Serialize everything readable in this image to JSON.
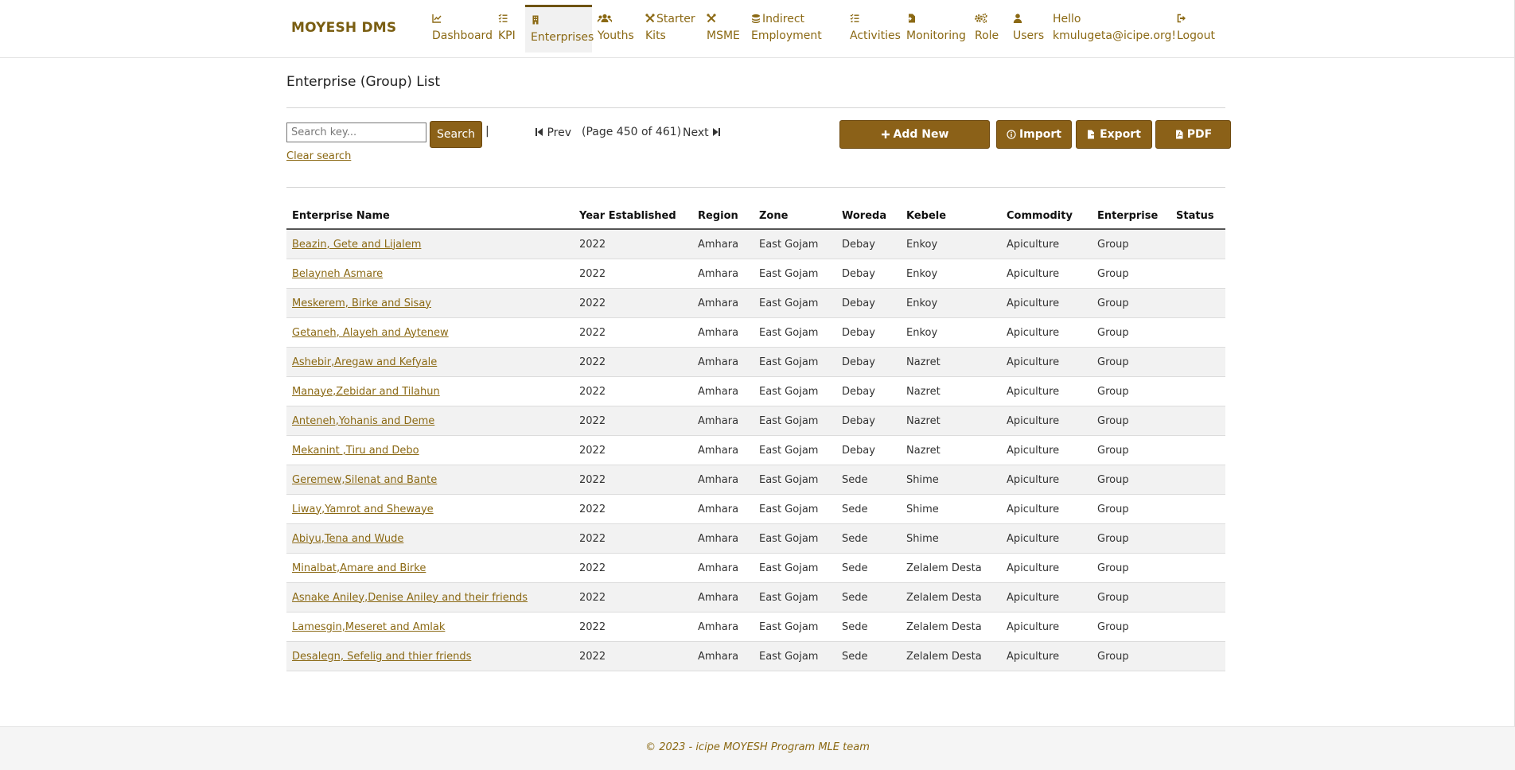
{
  "brand": "MOYESH DMS",
  "nav": [
    {
      "icon": "chart-line-icon",
      "line1": "",
      "line2": "Dashboard"
    },
    {
      "icon": "list-check-icon",
      "line1": "",
      "line2": "KPI"
    },
    {
      "icon": "building-icon",
      "line1": "",
      "line2": "Enterprises"
    },
    {
      "icon": "users-icon",
      "line1": "",
      "line2": "Youths"
    },
    {
      "icon": "tools-icon",
      "line1": "Starter",
      "line2": "Kits"
    },
    {
      "icon": "tools-icon",
      "line1": "",
      "line2": "MSME"
    },
    {
      "icon": "coins-icon",
      "line1": "Indirect",
      "line2": "Employment"
    },
    {
      "icon": "list-check-icon",
      "line1": "",
      "line2": "Activities"
    },
    {
      "icon": "file-import-icon",
      "line1": "",
      "line2": "Monitoring"
    },
    {
      "icon": "cogs-icon",
      "line1": "",
      "line2": "Role"
    },
    {
      "icon": "user-icon",
      "line1": "",
      "line2": "Users"
    },
    {
      "icon": "",
      "line1": "Hello",
      "line2": "kmulugeta@icipe.org!"
    },
    {
      "icon": "sign-out-icon",
      "line1": "",
      "line2": "Logout"
    }
  ],
  "page_title": "Enterprise (Group) List",
  "search": {
    "placeholder": "Search key...",
    "button": "Search",
    "separator": "|",
    "clear": "Clear search"
  },
  "pager": {
    "prev": "Prev",
    "info": "(Page 450 of 461)",
    "next": "Next"
  },
  "actions": {
    "add": "Add New",
    "import": "Import",
    "export": "Export",
    "pdf": "PDF"
  },
  "table": {
    "headers": [
      "Enterprise Name",
      "Year Established",
      "Region",
      "Zone",
      "Woreda",
      "Kebele",
      "Commodity",
      "Enterprise",
      "Status"
    ],
    "rows": [
      [
        "Beazin, Gete and Lijalem",
        "2022",
        "Amhara",
        "East Gojam",
        "Debay",
        "Enkoy",
        "Apiculture",
        "Group",
        ""
      ],
      [
        "Belayneh Asmare",
        "2022",
        "Amhara",
        "East Gojam",
        "Debay",
        "Enkoy",
        "Apiculture",
        "Group",
        ""
      ],
      [
        "Meskerem, Birke and Sisay",
        "2022",
        "Amhara",
        "East Gojam",
        "Debay",
        "Enkoy",
        "Apiculture",
        "Group",
        ""
      ],
      [
        "Getaneh, Alayeh and Aytenew",
        "2022",
        "Amhara",
        "East Gojam",
        "Debay",
        "Enkoy",
        "Apiculture",
        "Group",
        ""
      ],
      [
        "Ashebir,Aregaw and Kefyale",
        "2022",
        "Amhara",
        "East Gojam",
        "Debay",
        "Nazret",
        "Apiculture",
        "Group",
        ""
      ],
      [
        "Manaye,Zebidar and Tilahun",
        "2022",
        "Amhara",
        "East Gojam",
        "Debay",
        "Nazret",
        "Apiculture",
        "Group",
        ""
      ],
      [
        "Anteneh,Yohanis and Deme",
        "2022",
        "Amhara",
        "East Gojam",
        "Debay",
        "Nazret",
        "Apiculture",
        "Group",
        ""
      ],
      [
        "Mekanint ,Tiru and Debo",
        "2022",
        "Amhara",
        "East Gojam",
        "Debay",
        "Nazret",
        "Apiculture",
        "Group",
        ""
      ],
      [
        "Geremew,Silenat and Bante",
        "2022",
        "Amhara",
        "East Gojam",
        "Sede",
        "Shime",
        "Apiculture",
        "Group",
        ""
      ],
      [
        "Liway,Yamrot and Shewaye",
        "2022",
        "Amhara",
        "East Gojam",
        "Sede",
        "Shime",
        "Apiculture",
        "Group",
        ""
      ],
      [
        "Abiyu,Tena and Wude",
        "2022",
        "Amhara",
        "East Gojam",
        "Sede",
        "Shime",
        "Apiculture",
        "Group",
        ""
      ],
      [
        "Minalbat,Amare and Birke",
        "2022",
        "Amhara",
        "East Gojam",
        "Sede",
        "Zelalem Desta",
        "Apiculture",
        "Group",
        ""
      ],
      [
        "Asnake Aniley,Denise Aniley and their friends",
        "2022",
        "Amhara",
        "East Gojam",
        "Sede",
        "Zelalem Desta",
        "Apiculture",
        "Group",
        ""
      ],
      [
        "Lamesgin,Meseret and Amlak",
        "2022",
        "Amhara",
        "East Gojam",
        "Sede",
        "Zelalem Desta",
        "Apiculture",
        "Group",
        ""
      ],
      [
        "Desalegn, Sefelig and thier friends",
        "2022",
        "Amhara",
        "East Gojam",
        "Sede",
        "Zelalem Desta",
        "Apiculture",
        "Group",
        ""
      ]
    ]
  },
  "footer": "© 2023 - icipe MOYESH Program MLE team",
  "colors": {
    "accent": "#8b6118",
    "link": "#8b6914",
    "active_bar": "#6e5312"
  }
}
